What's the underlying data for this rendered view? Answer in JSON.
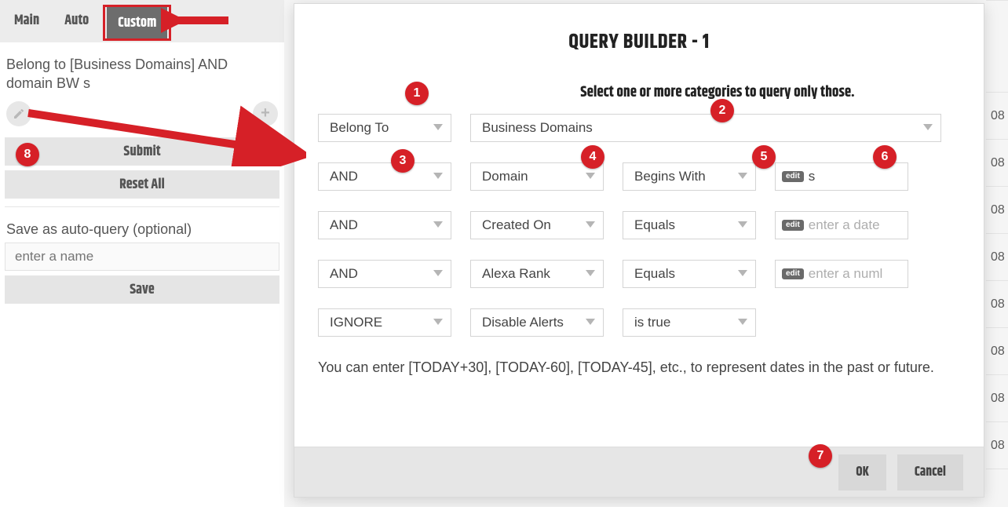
{
  "tabs": {
    "main": "Main",
    "auto": "Auto",
    "custom": "Custom"
  },
  "sidebar": {
    "query_text": "Belong to [Business Domains] AND domain BW s",
    "submit": "Submit",
    "reset": "Reset All",
    "save_label": "Save as auto-query (optional)",
    "name_placeholder": "enter a name",
    "save_btn": "Save"
  },
  "dialog": {
    "title": "QUERY BUILDER - 1",
    "subheader": "Select one or more categories to query only those.",
    "rows": [
      {
        "op": "Belong To",
        "category": "Business Domains"
      },
      {
        "bool": "AND",
        "field": "Domain",
        "cmp": "Begins With",
        "edit": "edit",
        "value": "s",
        "placeholder": ""
      },
      {
        "bool": "AND",
        "field": "Created On",
        "cmp": "Equals",
        "edit": "edit",
        "value": "",
        "placeholder": "enter a date"
      },
      {
        "bool": "AND",
        "field": "Alexa Rank",
        "cmp": "Equals",
        "edit": "edit",
        "value": "",
        "placeholder": "enter a numl"
      },
      {
        "bool": "IGNORE",
        "field": "Disable Alerts",
        "cmp": "is true"
      }
    ],
    "hint": "You can enter [TODAY+30], [TODAY-60], [TODAY-45], etc., to represent dates in the past or future.",
    "ok": "OK",
    "cancel": "Cancel"
  },
  "bg_cell": "08",
  "annotations": [
    "1",
    "2",
    "3",
    "4",
    "5",
    "6",
    "7",
    "8"
  ]
}
